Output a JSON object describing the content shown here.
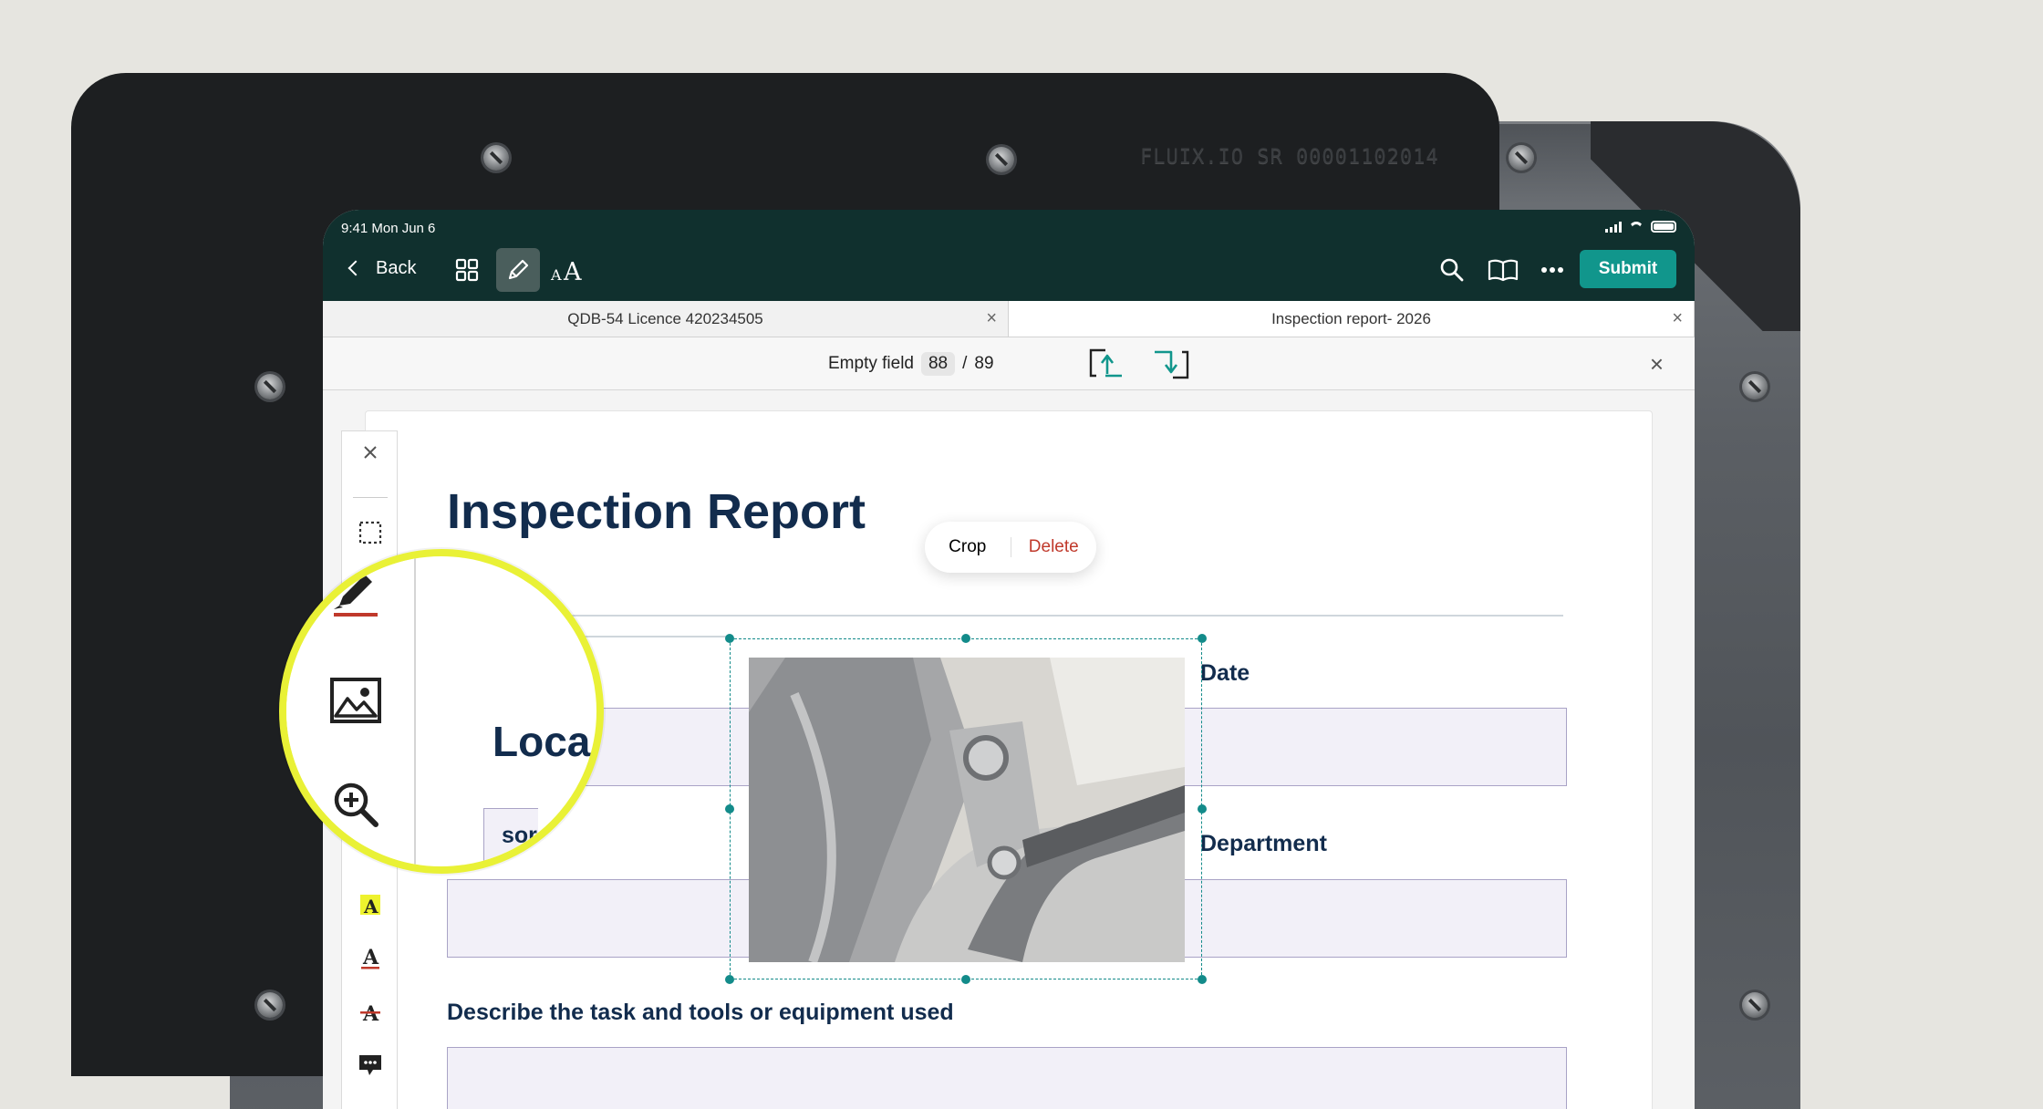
{
  "device": {
    "engraving": "FLUIX.IO  SR 00001102014"
  },
  "status": {
    "time_date": "9:41  Mon Jun 6"
  },
  "toolbar": {
    "back_label": "Back",
    "submit_label": "Submit"
  },
  "tabs": [
    {
      "label": "QDB-54 Licence 420234505",
      "close": "×"
    },
    {
      "label": "Inspection report- 2026",
      "close": "×"
    }
  ],
  "fieldbar": {
    "label": "Empty field",
    "current": "88",
    "separator": "/",
    "total": "89",
    "close": "×"
  },
  "document": {
    "title": "Inspection Report",
    "fields": {
      "date": "Date",
      "department": "Department",
      "describe": "Describe the task and tools or equipment used"
    }
  },
  "popover": {
    "crop": "Crop",
    "delete": "Delete"
  },
  "magnifier": {
    "text_location": "Loca",
    "text_name": "sor name"
  },
  "colors": {
    "topbar": "#10302e",
    "accent": "#11968c",
    "title": "#122c4d",
    "highlight": "#e9f136",
    "delete": "#c0392b"
  }
}
